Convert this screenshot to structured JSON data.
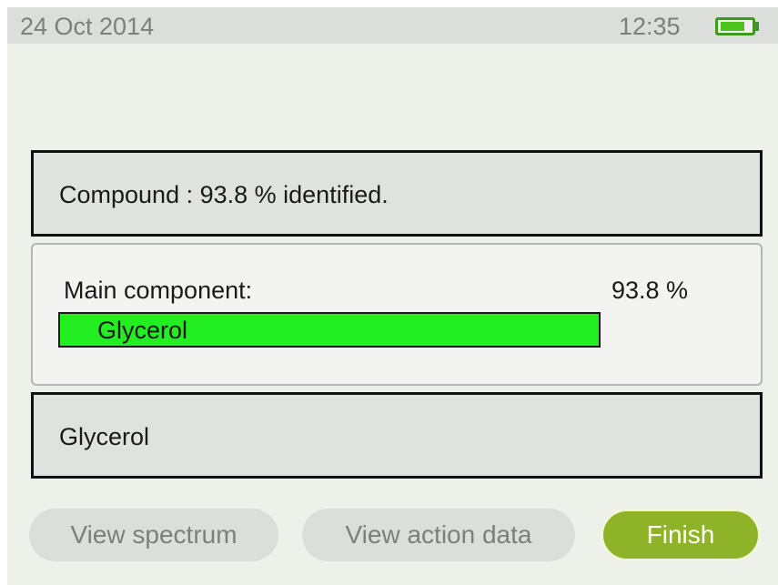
{
  "status_bar": {
    "date": "24 Oct 2014",
    "time": "12:35",
    "battery_icon": "battery-full-icon",
    "battery_level": 0.85,
    "battery_color": "#4ec41e"
  },
  "result": {
    "text": "Compound : 93.8 % identified."
  },
  "component": {
    "label": "Main component:",
    "percent_text": "93.8 %",
    "name": "Glycerol",
    "match_fraction": 1.0,
    "bar_color": "#22ee22"
  },
  "identified_name": "Glycerol",
  "buttons": {
    "view_spectrum": "View spectrum",
    "view_action_data": "View action data",
    "finish": "Finish"
  },
  "colors": {
    "accent": "#8fb328",
    "disabled_button": "#dcdedb"
  }
}
